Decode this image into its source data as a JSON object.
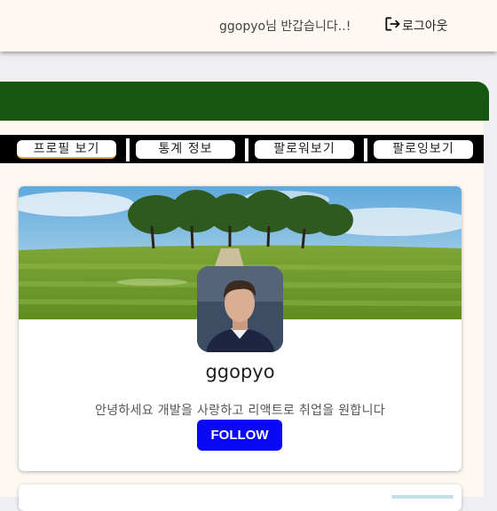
{
  "header": {
    "greeting": "ggopyo님 반갑습니다..!",
    "logout_label": "로그아웃"
  },
  "tabs": [
    {
      "label": "프로필 보기",
      "active": true
    },
    {
      "label": "통계 정보",
      "active": false
    },
    {
      "label": "팔로워보기",
      "active": false
    },
    {
      "label": "팔로잉보기",
      "active": false
    }
  ],
  "profile": {
    "username": "ggopyo",
    "bio": "안녕하세요 개발을 사랑하고 리액트로 취업을 원합니다",
    "follow_label": "FOLLOW"
  },
  "colors": {
    "header_bg": "#fdf8f1",
    "nav_green": "#155711",
    "follow_blue": "#0a08f5",
    "tab_active_underline": "#e8a535"
  },
  "icons": {
    "logout": "logout-icon"
  }
}
